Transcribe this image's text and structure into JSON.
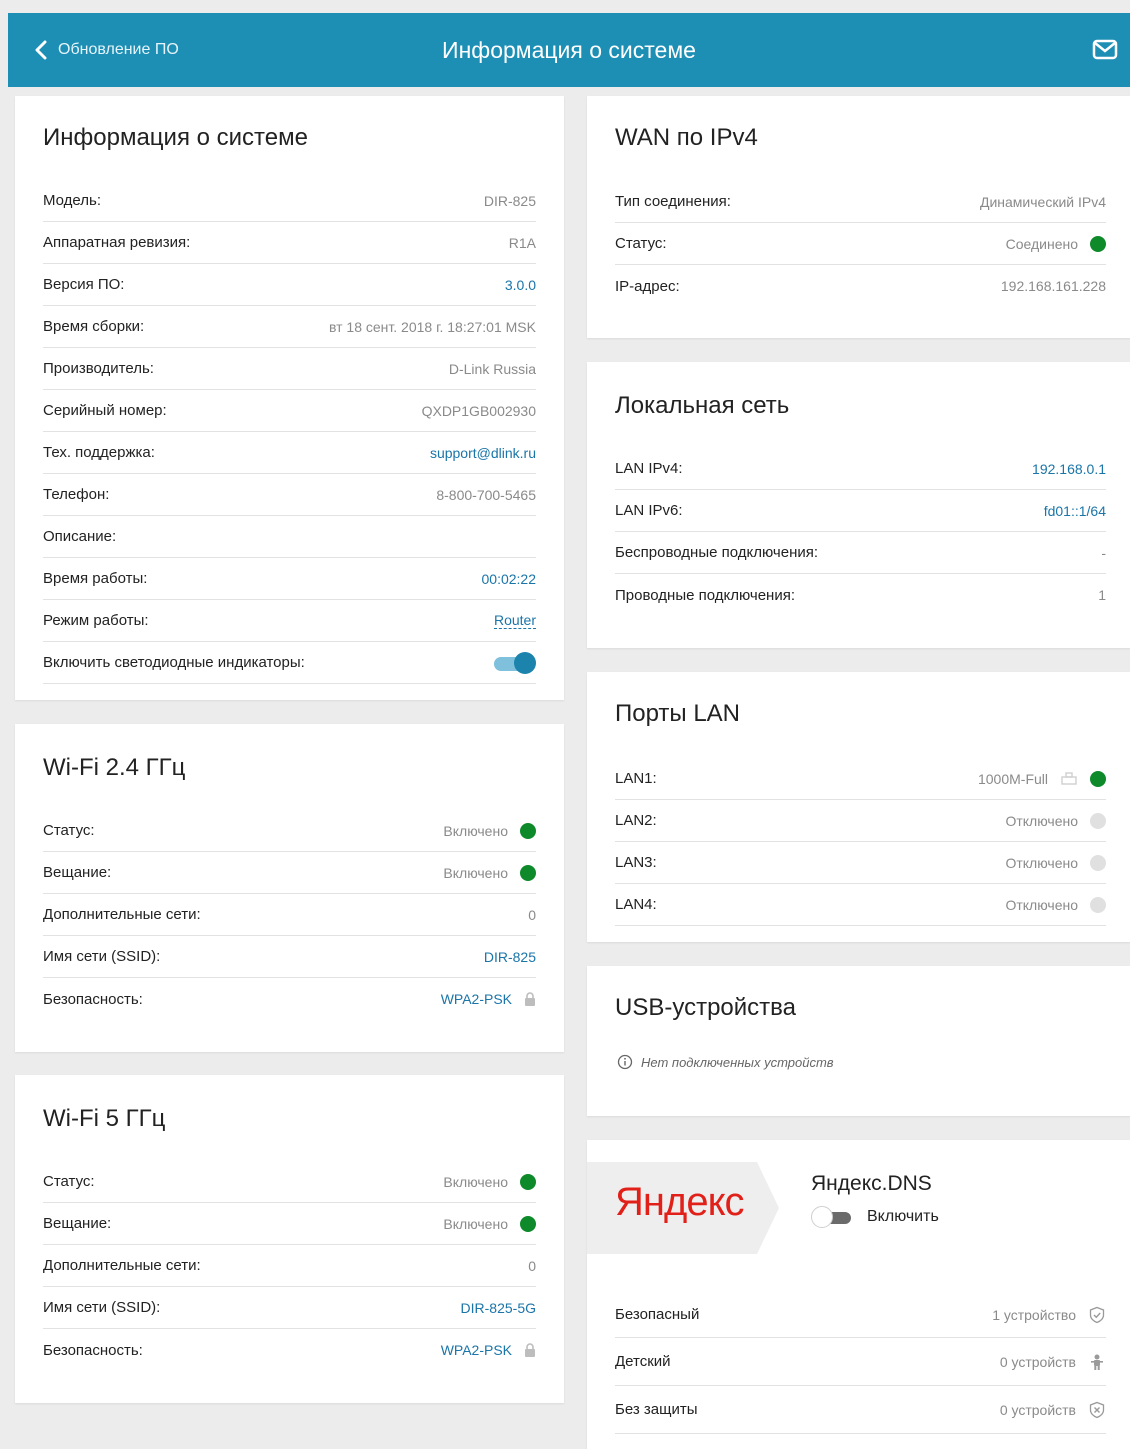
{
  "header": {
    "back_label": "Обновление ПО",
    "title": "Информация о системе"
  },
  "colors": {
    "header_bg": "#1d8fb5",
    "link": "#1a75a8",
    "status_green": "#0e8a2b",
    "status_grey": "#e0e0e0",
    "yandex_red": "#e2201a"
  },
  "system": {
    "title": "Информация о системе",
    "rows": [
      {
        "label": "Модель:",
        "value": "DIR-825"
      },
      {
        "label": "Аппаратная ревизия:",
        "value": "R1A"
      },
      {
        "label": "Версия ПО:",
        "value": "3.0.0"
      },
      {
        "label": "Время сборки:",
        "value": "вт 18 сент. 2018 г. 18:27:01 MSK"
      },
      {
        "label": "Производитель:",
        "value": "D-Link Russia"
      },
      {
        "label": "Серийный номер:",
        "value": "QXDP1GB002930"
      },
      {
        "label": "Тех. поддержка:",
        "value": "support@dlink.ru"
      },
      {
        "label": "Телефон:",
        "value": "8-800-700-5465"
      },
      {
        "label": "Описание:",
        "value": ""
      },
      {
        "label": "Время работы:",
        "value": "00:02:22"
      },
      {
        "label": "Режим работы:",
        "value": "Router"
      },
      {
        "label": "Включить светодиодные индикаторы:",
        "value": ""
      }
    ],
    "led_enabled": true
  },
  "wifi24": {
    "title": "Wi-Fi 2.4 ГГц",
    "rows": [
      {
        "label": "Статус:",
        "value": "Включено"
      },
      {
        "label": "Вещание:",
        "value": "Включено"
      },
      {
        "label": "Дополнительные сети:",
        "value": "0"
      },
      {
        "label": "Имя сети (SSID):",
        "value": "DIR-825"
      },
      {
        "label": "Безопасность:",
        "value": "WPA2-PSK"
      }
    ]
  },
  "wifi5": {
    "title": "Wi-Fi 5 ГГц",
    "rows": [
      {
        "label": "Статус:",
        "value": "Включено"
      },
      {
        "label": "Вещание:",
        "value": "Включено"
      },
      {
        "label": "Дополнительные сети:",
        "value": "0"
      },
      {
        "label": "Имя сети (SSID):",
        "value": "DIR-825-5G"
      },
      {
        "label": "Безопасность:",
        "value": "WPA2-PSK"
      }
    ]
  },
  "wan": {
    "title": "WAN по IPv4",
    "rows": [
      {
        "label": "Тип соединения:",
        "value": "Динамический IPv4"
      },
      {
        "label": "Статус:",
        "value": "Соединено"
      },
      {
        "label": "IP-адрес:",
        "value": "192.168.161.228"
      }
    ]
  },
  "lan": {
    "title": "Локальная сеть",
    "rows": [
      {
        "label": "LAN IPv4:",
        "value": "192.168.0.1"
      },
      {
        "label": "LAN IPv6:",
        "value": "fd01::1/64"
      },
      {
        "label": "Беспроводные подключения:",
        "value": "-"
      },
      {
        "label": "Проводные подключения:",
        "value": "1"
      }
    ]
  },
  "ports": {
    "title": "Порты LAN",
    "rows": [
      {
        "label": "LAN1:",
        "value": "1000M-Full",
        "state": "up"
      },
      {
        "label": "LAN2:",
        "value": "Отключено",
        "state": "down"
      },
      {
        "label": "LAN3:",
        "value": "Отключено",
        "state": "down"
      },
      {
        "label": "LAN4:",
        "value": "Отключено",
        "state": "down"
      }
    ]
  },
  "usb": {
    "title": "USB-устройства",
    "note": "Нет подключенных устройств"
  },
  "yandex": {
    "logo": "Яндекс",
    "title": "Яндекс.DNS",
    "toggle_label": "Включить",
    "enabled": false,
    "rows": [
      {
        "label": "Безопасный",
        "value": "1 устройство",
        "icon": "shield-check-icon"
      },
      {
        "label": "Детский",
        "value": "0 устройств",
        "icon": "child-icon"
      },
      {
        "label": "Без защиты",
        "value": "0 устройств",
        "icon": "shield-x-icon"
      }
    ]
  }
}
